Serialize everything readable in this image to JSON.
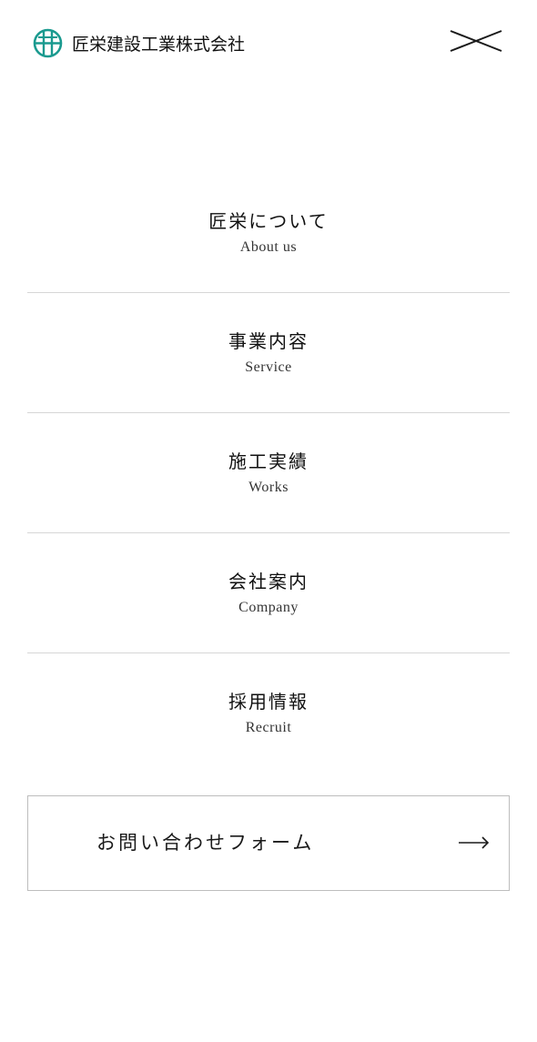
{
  "header": {
    "company_name": "匠栄建設工業株式会社",
    "logo_icon": "company-logo-emblem",
    "close_icon": "close-x-icon",
    "accent_color": "#1a9a8f"
  },
  "nav": {
    "items": [
      {
        "ja": "匠栄について",
        "en": "About us"
      },
      {
        "ja": "事業内容",
        "en": "Service"
      },
      {
        "ja": "施工実績",
        "en": "Works"
      },
      {
        "ja": "会社案内",
        "en": "Company"
      },
      {
        "ja": "採用情報",
        "en": "Recruit"
      }
    ]
  },
  "contact": {
    "label": "お問い合わせフォーム",
    "arrow_icon": "arrow-right-icon"
  }
}
